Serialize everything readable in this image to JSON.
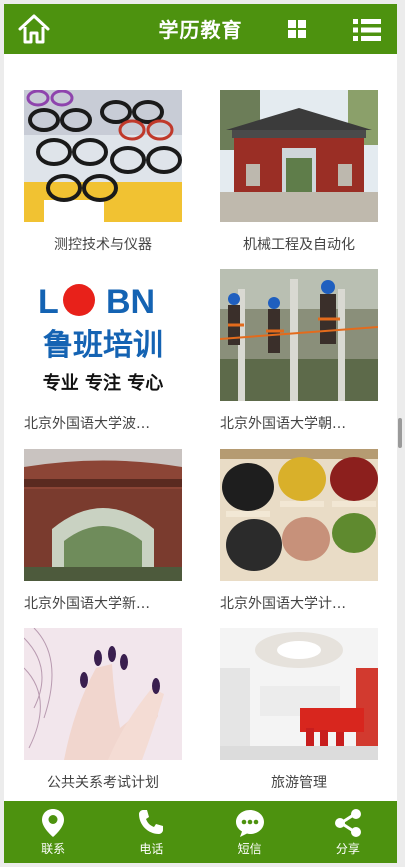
{
  "header": {
    "title": "学历教育",
    "home_icon": "home-icon",
    "grid_icon": "grid-view-icon",
    "menu_icon": "list-menu-icon"
  },
  "items": [
    {
      "caption": "测控技术与仪器",
      "image": "eyeglasses-photo"
    },
    {
      "caption": "机械工程及自动化",
      "image": "campus-gate-photo"
    },
    {
      "caption": "北京外国语大学波…",
      "image": "luban-training-logo"
    },
    {
      "caption": "北京外国语大学朝…",
      "image": "lineworkers-photo"
    },
    {
      "caption": "北京外国语大学新…",
      "image": "campus-arch-photo"
    },
    {
      "caption": "北京外国语大学计…",
      "image": "grain-jars-photo"
    },
    {
      "caption": "公共关系考试计划",
      "image": "manicure-photo"
    },
    {
      "caption": "旅游管理",
      "image": "office-lobby-photo"
    }
  ],
  "logo_text": {
    "brand": "LOBN",
    "name": "鲁班培训",
    "slogan": "专业 专注 专心"
  },
  "footer": {
    "items": [
      {
        "label": "联系",
        "icon": "location-pin-icon"
      },
      {
        "label": "电话",
        "icon": "phone-icon"
      },
      {
        "label": "短信",
        "icon": "message-icon"
      },
      {
        "label": "分享",
        "icon": "share-icon"
      }
    ]
  },
  "colors": {
    "brand_green": "#4d920f",
    "logo_blue": "#1463b3",
    "logo_red": "#e8211a"
  }
}
